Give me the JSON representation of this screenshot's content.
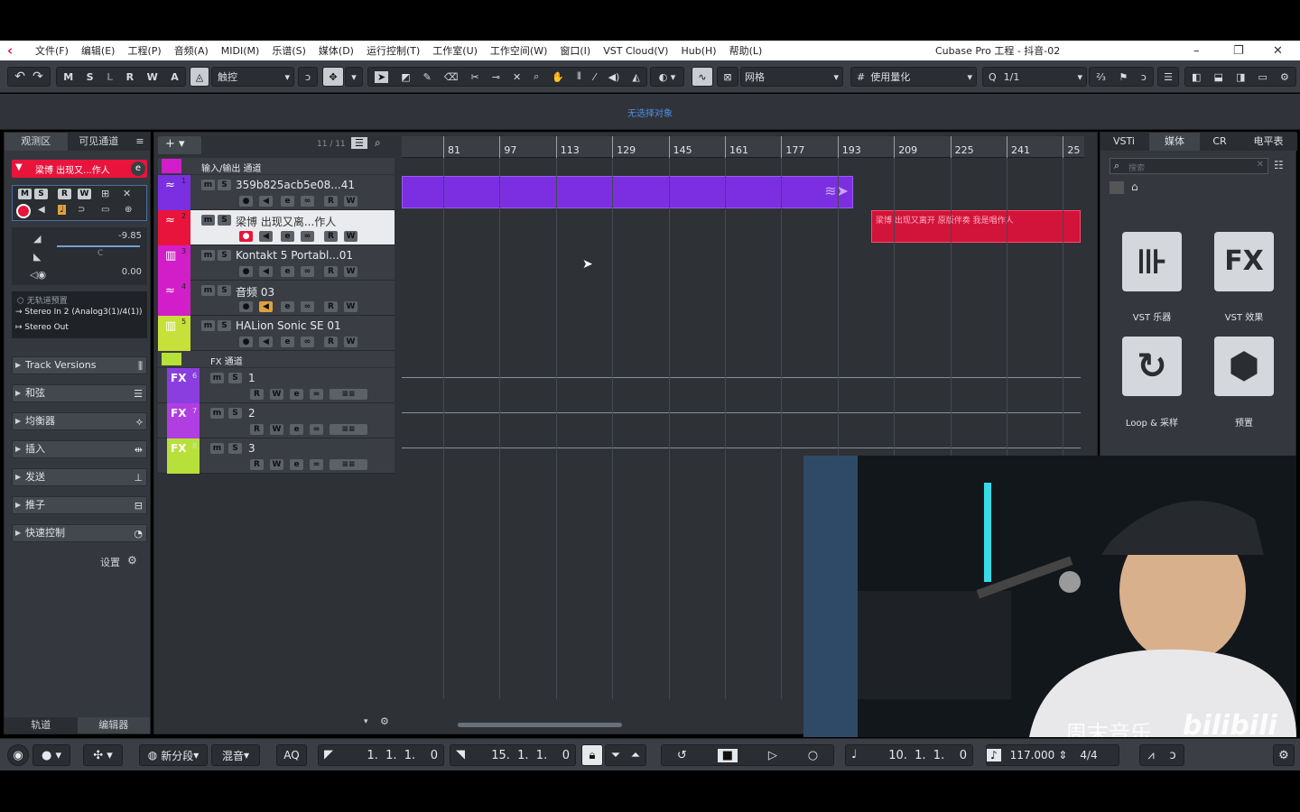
{
  "window": {
    "title": "Cubase Pro 工程 - 抖音-02",
    "controls": [
      "–",
      "❐",
      "✕"
    ]
  },
  "menu": [
    "文件(F)",
    "编辑(E)",
    "工程(P)",
    "音频(A)",
    "MIDI(M)",
    "乐谱(S)",
    "媒体(D)",
    "运行控制(T)",
    "工作室(U)",
    "工作空间(W)",
    "窗口(I)",
    "VST Cloud(V)",
    "Hub(H)",
    "帮助(L)"
  ],
  "toolbar": {
    "undo": "↶",
    "redo": "↷",
    "m": "M",
    "s": "S",
    "l": "L",
    "r": "R",
    "w": "W",
    "a": "A",
    "automation_mode": "触控",
    "snap_type": "网格",
    "quantize_mode": "使用量化",
    "quantize_value": "1/1"
  },
  "infobar": {
    "text": "无选择对象"
  },
  "inspector": {
    "tabs": [
      "观测区",
      "可见通道"
    ],
    "channel_name": "梁博 出现又...作人",
    "buttons": {
      "m": "M",
      "s": "S",
      "r": "R",
      "w": "W"
    },
    "volume": "-9.85",
    "pan": "C",
    "delay": "0.00",
    "routing": {
      "eq": "无轨道预置",
      "input": "Stereo In 2 (Analog3(1)/4(1))",
      "output": "Stereo Out"
    },
    "sections": [
      "Track Versions",
      "和弦",
      "均衡器",
      "插入",
      "发送",
      "推子",
      "快速控制"
    ],
    "settings": "设置",
    "bottom_tabs": [
      "轨道",
      "编辑器"
    ]
  },
  "tracklist": {
    "count": "11 / 11",
    "folder_io": "输入/输出 通道",
    "folder_fx": "FX 通道",
    "tracks": [
      {
        "num": "1",
        "name": "359b825acb5e08...41",
        "color": "#7b2fe0"
      },
      {
        "num": "2",
        "name": "梁博 出现又离...作人",
        "color": "#e8143c"
      },
      {
        "num": "3",
        "name": "Kontakt 5 Portabl...01",
        "color": "#d21ec8"
      },
      {
        "num": "4",
        "name": "音频 03",
        "color": "#d21ec8"
      },
      {
        "num": "5",
        "name": "HALion Sonic SE 01",
        "color": "#c8e03a"
      }
    ],
    "fx": [
      {
        "label": "FX",
        "num": "6",
        "name": "1",
        "color": "#8a3ee0"
      },
      {
        "label": "FX",
        "num": "7",
        "name": "2",
        "color": "#b03ee0"
      },
      {
        "label": "FX",
        "num": "8",
        "name": "3",
        "color": "#b8e03a"
      }
    ]
  },
  "ruler": {
    "bars": [
      "81",
      "97",
      "113",
      "129",
      "145",
      "161",
      "177",
      "193",
      "209",
      "225",
      "241",
      "25"
    ]
  },
  "events": {
    "red_label": "梁博 出现又离开 原版伴奏 我是唱作人"
  },
  "rightzone": {
    "tabs": [
      "VSTi",
      "媒体",
      "CR",
      "电平表"
    ],
    "search_placeholder": "搜索",
    "tiles": [
      {
        "label": "VST 乐器",
        "glyph": "⊪"
      },
      {
        "label": "VST 效果",
        "glyph": "FX"
      },
      {
        "label": "Loop & 采样",
        "glyph": "↻"
      },
      {
        "label": "预置",
        "glyph": "⬢"
      }
    ]
  },
  "transport": {
    "new_part": "新分段",
    "mix": "混音",
    "aq": "AQ",
    "left_locator": "1.  1.  1.    0",
    "right_locator": "15.  1.  1.    0",
    "position": "10.  1.  1.    0",
    "tempo": "117.000",
    "signature": "4/4"
  },
  "video": {
    "watermark": "周末音乐",
    "brand": "bilibili"
  }
}
